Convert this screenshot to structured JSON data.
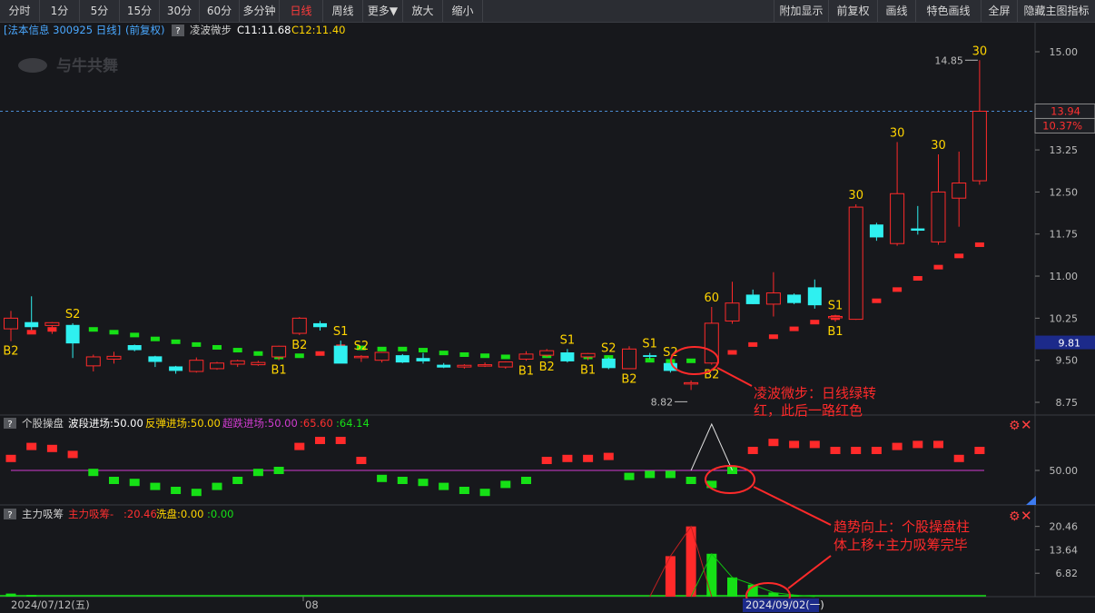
{
  "toolbar": {
    "left": [
      "分时",
      "1分",
      "5分",
      "15分",
      "30分",
      "60分",
      "多分钟",
      "日线",
      "周线",
      "更多▼",
      "放大",
      "缩小"
    ],
    "active": "日线",
    "right": [
      "附加显示",
      "前复权",
      "画线",
      "特色画线",
      "全屏",
      "隐藏主图指标"
    ]
  },
  "header": {
    "stock": "[法本信息 300925 日线]",
    "adjust": "(前复权)",
    "help": "?",
    "indicator_name": "凌波微步",
    "c11": "C11:11.68",
    "c12": "C12:11.40"
  },
  "watermark": "与牛共舞",
  "colors": {
    "up": "#ff2a2a",
    "down": "#2ff0f0",
    "green": "#16e016",
    "yellow": "#ffd400",
    "magenta": "#d03cd0",
    "annotation": "#ff2a2a",
    "blue": "#4aa8ff"
  },
  "price_axis": {
    "ticks": [
      "15.00",
      "13.25",
      "12.50",
      "11.75",
      "11.00",
      "10.25",
      "9.50",
      "8.75"
    ],
    "current_price": "13.94",
    "current_change": "10.37%",
    "low_box": "9.81"
  },
  "markers": {
    "high": "14.85",
    "low": "8.82"
  },
  "annotations": {
    "main": [
      "凌波微步：日线绿转",
      "红，此后一路红色"
    ],
    "lower": [
      "趋势向上：个股操盘柱",
      "体上移+主力吸筹完毕"
    ]
  },
  "pane2": {
    "help": "?",
    "name": "个股操盘",
    "l1": "波段进场:50.00",
    "l2": "反弹进场:50.00",
    "l3": "超跌进场:50.00",
    "v1": ":65.60",
    "v2": ":64.14",
    "axis": "50.00"
  },
  "pane3": {
    "help": "?",
    "name": "主力吸筹",
    "l1": "主力吸筹-",
    "v1": ":20.46",
    "l2": "洗盘:0.00",
    "v2": ":0.00",
    "axis": [
      "20.46",
      "13.64",
      "6.82"
    ]
  },
  "time_axis": {
    "start": "2024/07/12(五)",
    "mid": "08",
    "sel": "2024/09/02(一)"
  },
  "chart_data": {
    "type": "candlestick",
    "candles": [
      {
        "o": 10.06,
        "h": 10.38,
        "l": 9.84,
        "c": 10.25
      },
      {
        "o": 10.18,
        "h": 10.64,
        "l": 10.04,
        "c": 10.09
      },
      {
        "o": 10.12,
        "h": 10.18,
        "l": 9.97,
        "c": 10.17
      },
      {
        "o": 10.13,
        "h": 10.16,
        "l": 9.54,
        "c": 9.8
      },
      {
        "o": 9.4,
        "h": 9.6,
        "l": 9.3,
        "c": 9.56
      },
      {
        "o": 9.52,
        "h": 9.65,
        "l": 9.44,
        "c": 9.57
      },
      {
        "o": 9.77,
        "h": 9.78,
        "l": 9.66,
        "c": 9.68
      },
      {
        "o": 9.57,
        "h": 9.58,
        "l": 9.38,
        "c": 9.47
      },
      {
        "o": 9.39,
        "h": 9.4,
        "l": 9.26,
        "c": 9.31
      },
      {
        "o": 9.3,
        "h": 9.55,
        "l": 9.28,
        "c": 9.5
      },
      {
        "o": 9.35,
        "h": 9.47,
        "l": 9.33,
        "c": 9.45
      },
      {
        "o": 9.43,
        "h": 9.51,
        "l": 9.38,
        "c": 9.49
      },
      {
        "o": 9.42,
        "h": 9.49,
        "l": 9.4,
        "c": 9.46
      },
      {
        "o": 9.56,
        "h": 9.76,
        "l": 9.5,
        "c": 9.75
      },
      {
        "o": 9.98,
        "h": 10.27,
        "l": 9.95,
        "c": 10.25
      },
      {
        "o": 10.16,
        "h": 10.2,
        "l": 10.03,
        "c": 10.09
      },
      {
        "o": 9.76,
        "h": 9.85,
        "l": 9.45,
        "c": 9.44
      },
      {
        "o": 9.55,
        "h": 9.59,
        "l": 9.47,
        "c": 9.57
      },
      {
        "o": 9.5,
        "h": 9.65,
        "l": 9.46,
        "c": 9.64
      },
      {
        "o": 9.59,
        "h": 9.61,
        "l": 9.45,
        "c": 9.46
      },
      {
        "o": 9.54,
        "h": 9.63,
        "l": 9.44,
        "c": 9.48
      },
      {
        "o": 9.42,
        "h": 9.45,
        "l": 9.36,
        "c": 9.37
      },
      {
        "o": 9.38,
        "h": 9.43,
        "l": 9.35,
        "c": 9.41
      },
      {
        "o": 9.4,
        "h": 9.46,
        "l": 9.38,
        "c": 9.42
      },
      {
        "o": 9.38,
        "h": 9.48,
        "l": 9.35,
        "c": 9.47
      },
      {
        "o": 9.52,
        "h": 9.66,
        "l": 9.49,
        "c": 9.61
      },
      {
        "o": 9.59,
        "h": 9.7,
        "l": 9.56,
        "c": 9.67
      },
      {
        "o": 9.64,
        "h": 9.7,
        "l": 9.46,
        "c": 9.48
      },
      {
        "o": 9.56,
        "h": 9.63,
        "l": 9.5,
        "c": 9.62
      },
      {
        "o": 9.53,
        "h": 9.55,
        "l": 9.34,
        "c": 9.36
      },
      {
        "o": 9.35,
        "h": 9.75,
        "l": 9.34,
        "c": 9.7
      },
      {
        "o": 9.59,
        "h": 9.63,
        "l": 9.52,
        "c": 9.56
      },
      {
        "o": 9.45,
        "h": 9.48,
        "l": 9.28,
        "c": 9.31
      },
      {
        "o": 9.08,
        "h": 9.14,
        "l": 8.97,
        "c": 9.1
      },
      {
        "o": 9.45,
        "h": 10.45,
        "l": 9.42,
        "c": 10.16
      },
      {
        "o": 10.2,
        "h": 10.9,
        "l": 10.15,
        "c": 10.52
      },
      {
        "o": 10.67,
        "h": 10.76,
        "l": 10.5,
        "c": 10.5
      },
      {
        "o": 10.5,
        "h": 11.07,
        "l": 10.28,
        "c": 10.7
      },
      {
        "o": 10.67,
        "h": 10.69,
        "l": 10.5,
        "c": 10.52
      },
      {
        "o": 10.8,
        "h": 10.94,
        "l": 10.42,
        "c": 10.48
      },
      {
        "o": 10.26,
        "h": 10.31,
        "l": 10.19,
        "c": 10.28
      },
      {
        "o": 10.23,
        "h": 12.28,
        "l": 10.22,
        "c": 12.23
      },
      {
        "o": 11.92,
        "h": 11.95,
        "l": 11.63,
        "c": 11.69
      },
      {
        "o": 11.58,
        "h": 13.39,
        "l": 11.54,
        "c": 12.47
      },
      {
        "o": 11.85,
        "h": 12.25,
        "l": 11.74,
        "c": 11.81
      },
      {
        "o": 11.61,
        "h": 13.17,
        "l": 11.56,
        "c": 12.5
      },
      {
        "o": 12.39,
        "h": 13.22,
        "l": 11.88,
        "c": 12.66
      },
      {
        "o": 12.7,
        "h": 14.85,
        "l": 12.63,
        "c": 13.94
      }
    ],
    "signal_dots": [
      {
        "i": 1,
        "v": 10.0,
        "c": "red"
      },
      {
        "i": 2,
        "v": 10.05,
        "c": "red"
      },
      {
        "i": 3,
        "v": 10.07,
        "c": "green"
      },
      {
        "i": 4,
        "v": 10.05,
        "c": "green"
      },
      {
        "i": 5,
        "v": 10.0,
        "c": "green"
      },
      {
        "i": 6,
        "v": 9.95,
        "c": "green"
      },
      {
        "i": 7,
        "v": 9.88,
        "c": "green"
      },
      {
        "i": 8,
        "v": 9.83,
        "c": "green"
      },
      {
        "i": 9,
        "v": 9.78,
        "c": "green"
      },
      {
        "i": 10,
        "v": 9.73,
        "c": "green"
      },
      {
        "i": 11,
        "v": 9.68,
        "c": "green"
      },
      {
        "i": 12,
        "v": 9.62,
        "c": "green"
      },
      {
        "i": 13,
        "v": 9.56,
        "c": "green"
      },
      {
        "i": 14,
        "v": 9.58,
        "c": "green"
      },
      {
        "i": 15,
        "v": 9.62,
        "c": "red"
      },
      {
        "i": 16,
        "v": 9.74,
        "c": "red"
      },
      {
        "i": 17,
        "v": 9.72,
        "c": "green"
      },
      {
        "i": 18,
        "v": 9.7,
        "c": "green"
      },
      {
        "i": 19,
        "v": 9.7,
        "c": "green"
      },
      {
        "i": 20,
        "v": 9.68,
        "c": "green"
      },
      {
        "i": 21,
        "v": 9.63,
        "c": "green"
      },
      {
        "i": 22,
        "v": 9.6,
        "c": "green"
      },
      {
        "i": 23,
        "v": 9.58,
        "c": "green"
      },
      {
        "i": 24,
        "v": 9.56,
        "c": "green"
      },
      {
        "i": 25,
        "v": 9.56,
        "c": "green"
      },
      {
        "i": 26,
        "v": 9.58,
        "c": "green"
      },
      {
        "i": 27,
        "v": 9.58,
        "c": "green"
      },
      {
        "i": 28,
        "v": 9.56,
        "c": "green"
      },
      {
        "i": 29,
        "v": 9.55,
        "c": "green"
      },
      {
        "i": 30,
        "v": 9.52,
        "c": "green"
      },
      {
        "i": 31,
        "v": 9.5,
        "c": "green"
      },
      {
        "i": 32,
        "v": 9.48,
        "c": "green"
      },
      {
        "i": 33,
        "v": 9.49,
        "c": "green"
      },
      {
        "i": 34,
        "v": 9.5,
        "c": "red"
      },
      {
        "i": 35,
        "v": 9.64,
        "c": "red"
      },
      {
        "i": 36,
        "v": 9.78,
        "c": "red"
      },
      {
        "i": 37,
        "v": 9.92,
        "c": "red"
      },
      {
        "i": 38,
        "v": 10.06,
        "c": "red"
      },
      {
        "i": 39,
        "v": 10.18,
        "c": "red"
      },
      {
        "i": 40,
        "v": 10.26,
        "c": "red"
      },
      {
        "i": 41,
        "v": 10.4,
        "c": "red"
      },
      {
        "i": 42,
        "v": 10.56,
        "c": "red"
      },
      {
        "i": 43,
        "v": 10.76,
        "c": "red"
      },
      {
        "i": 44,
        "v": 10.96,
        "c": "red"
      },
      {
        "i": 45,
        "v": 11.16,
        "c": "red"
      },
      {
        "i": 46,
        "v": 11.36,
        "c": "red"
      },
      {
        "i": 47,
        "v": 11.56,
        "c": "red"
      }
    ],
    "labels": [
      {
        "i": 0,
        "t": "B2",
        "pos": "below"
      },
      {
        "i": 3,
        "t": "S2",
        "pos": "above"
      },
      {
        "i": 13,
        "t": "B1",
        "pos": "below"
      },
      {
        "i": 14,
        "t": "B2",
        "pos": "below"
      },
      {
        "i": 16,
        "t": "S1",
        "pos": "above"
      },
      {
        "i": 17,
        "t": "S2",
        "pos": "above"
      },
      {
        "i": 25,
        "t": "B1",
        "pos": "below"
      },
      {
        "i": 26,
        "t": "B2",
        "pos": "below"
      },
      {
        "i": 27,
        "t": "S1",
        "pos": "above"
      },
      {
        "i": 28,
        "t": "B1",
        "pos": "below"
      },
      {
        "i": 29,
        "t": "S2",
        "pos": "above"
      },
      {
        "i": 30,
        "t": "B2",
        "pos": "below"
      },
      {
        "i": 31,
        "t": "S1",
        "pos": "above"
      },
      {
        "i": 32,
        "t": "S2",
        "pos": "above"
      },
      {
        "i": 34,
        "t": "B2",
        "pos": "below"
      },
      {
        "i": 34,
        "t": "60",
        "pos": "above"
      },
      {
        "i": 40,
        "t": "S1",
        "pos": "above"
      },
      {
        "i": 40,
        "t": "B1",
        "pos": "below"
      },
      {
        "i": 41,
        "t": "30",
        "pos": "above"
      },
      {
        "i": 43,
        "t": "30",
        "pos": "above"
      },
      {
        "i": 45,
        "t": "30",
        "pos": "above"
      },
      {
        "i": 47,
        "t": "30",
        "pos": "above"
      }
    ],
    "pane2_bars": [
      {
        "i": 0,
        "v": 50.6
      },
      {
        "i": 1,
        "v": 51.2
      },
      {
        "i": 2,
        "v": 51.1
      },
      {
        "i": 3,
        "v": 50.8
      },
      {
        "i": 4,
        "v": 49.9
      },
      {
        "i": 5,
        "v": 49.5
      },
      {
        "i": 6,
        "v": 49.4
      },
      {
        "i": 7,
        "v": 49.2
      },
      {
        "i": 8,
        "v": 49.0
      },
      {
        "i": 9,
        "v": 48.9
      },
      {
        "i": 10,
        "v": 49.2
      },
      {
        "i": 11,
        "v": 49.5
      },
      {
        "i": 12,
        "v": 49.9
      },
      {
        "i": 13,
        "v": 50.0
      },
      {
        "i": 14,
        "v": 51.2
      },
      {
        "i": 15,
        "v": 51.5
      },
      {
        "i": 16,
        "v": 51.5
      },
      {
        "i": 17,
        "v": 50.5
      },
      {
        "i": 18,
        "v": 49.6
      },
      {
        "i": 19,
        "v": 49.5
      },
      {
        "i": 20,
        "v": 49.4
      },
      {
        "i": 21,
        "v": 49.2
      },
      {
        "i": 22,
        "v": 49.0
      },
      {
        "i": 23,
        "v": 48.9
      },
      {
        "i": 24,
        "v": 49.3
      },
      {
        "i": 25,
        "v": 49.5
      },
      {
        "i": 26,
        "v": 50.5
      },
      {
        "i": 27,
        "v": 50.6
      },
      {
        "i": 28,
        "v": 50.6
      },
      {
        "i": 29,
        "v": 50.7
      },
      {
        "i": 30,
        "v": 49.7
      },
      {
        "i": 31,
        "v": 49.8
      },
      {
        "i": 32,
        "v": 49.8
      },
      {
        "i": 33,
        "v": 49.5
      },
      {
        "i": 34,
        "v": 49.3
      },
      {
        "i": 35,
        "v": 50.0
      },
      {
        "i": 36,
        "v": 51.0
      },
      {
        "i": 37,
        "v": 51.4
      },
      {
        "i": 38,
        "v": 51.3
      },
      {
        "i": 39,
        "v": 51.3
      },
      {
        "i": 40,
        "v": 51.0
      },
      {
        "i": 41,
        "v": 51.0
      },
      {
        "i": 42,
        "v": 51.0
      },
      {
        "i": 43,
        "v": 51.2
      },
      {
        "i": 44,
        "v": 51.3
      },
      {
        "i": 45,
        "v": 51.3
      },
      {
        "i": 46,
        "v": 50.6
      },
      {
        "i": 47,
        "v": 51.0
      }
    ],
    "pane3_bars": [
      {
        "i": 0,
        "v": 0.9,
        "c": "green"
      },
      {
        "i": 1,
        "v": 0.5,
        "c": "green"
      },
      {
        "i": 32,
        "v": 11.8,
        "c": "red"
      },
      {
        "i": 33,
        "v": 20.46,
        "c": "red"
      },
      {
        "i": 34,
        "v": 12.5,
        "c": "green"
      },
      {
        "i": 35,
        "v": 5.6,
        "c": "green"
      },
      {
        "i": 36,
        "v": 3.5,
        "c": "green"
      },
      {
        "i": 37,
        "v": 1.2,
        "c": "green"
      },
      {
        "i": 38,
        "v": 0.5,
        "c": "green"
      }
    ]
  }
}
